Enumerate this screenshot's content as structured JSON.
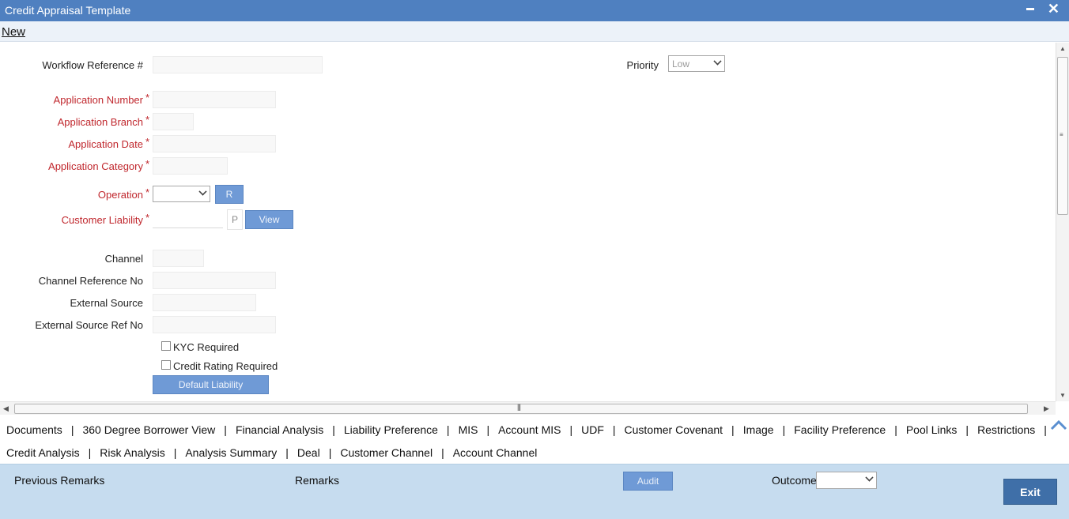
{
  "window": {
    "title": "Credit Appraisal Template",
    "minimize_glyph": "",
    "close_glyph": "✕"
  },
  "menu": {
    "new_label": "New"
  },
  "form": {
    "workflow_ref": {
      "label": "Workflow Reference #",
      "value": ""
    },
    "priority": {
      "label": "Priority",
      "value": "Low"
    },
    "application_number": {
      "label": "Application Number",
      "value": ""
    },
    "application_branch": {
      "label": "Application Branch",
      "value": ""
    },
    "application_date": {
      "label": "Application Date",
      "value": ""
    },
    "application_category": {
      "label": "Application Category",
      "value": ""
    },
    "operation": {
      "label": "Operation",
      "value": "",
      "button": "R"
    },
    "customer_liability": {
      "label": "Customer Liability",
      "value": "",
      "p_label": "P",
      "view_button": "View"
    },
    "channel": {
      "label": "Channel",
      "value": ""
    },
    "channel_ref": {
      "label": "Channel Reference No",
      "value": ""
    },
    "external_source": {
      "label": "External Source",
      "value": ""
    },
    "external_source_ref": {
      "label": "External Source Ref No",
      "value": ""
    },
    "kyc_required": {
      "label": "KYC Required",
      "checked": false
    },
    "credit_rating_required": {
      "label": "Credit Rating Required",
      "checked": false
    },
    "default_liability_button": "Default Liability",
    "required_marker": "*"
  },
  "tabs": {
    "row1": [
      "Documents",
      "360 Degree Borrower View",
      "Financial Analysis",
      "Liability Preference",
      "MIS",
      "Account MIS",
      "UDF",
      "Customer Covenant",
      "Image",
      "Facility Preference",
      "Pool Links",
      "Restrictions"
    ],
    "row2": [
      "Credit Analysis",
      "Risk Analysis",
      "Analysis Summary",
      "Deal",
      "Customer Channel",
      "Account Channel"
    ],
    "separator": "|"
  },
  "footer": {
    "previous_remarks": "Previous Remarks",
    "remarks": "Remarks",
    "audit_button": "Audit",
    "outcome_label": "Outcome",
    "outcome_value": "",
    "exit_button": "Exit"
  },
  "colors": {
    "titlebar": "#4f80c0",
    "required": "#c0272d",
    "button": "#6f9ad6",
    "footer": "#c6dcef",
    "exit": "#3f6fa8"
  }
}
